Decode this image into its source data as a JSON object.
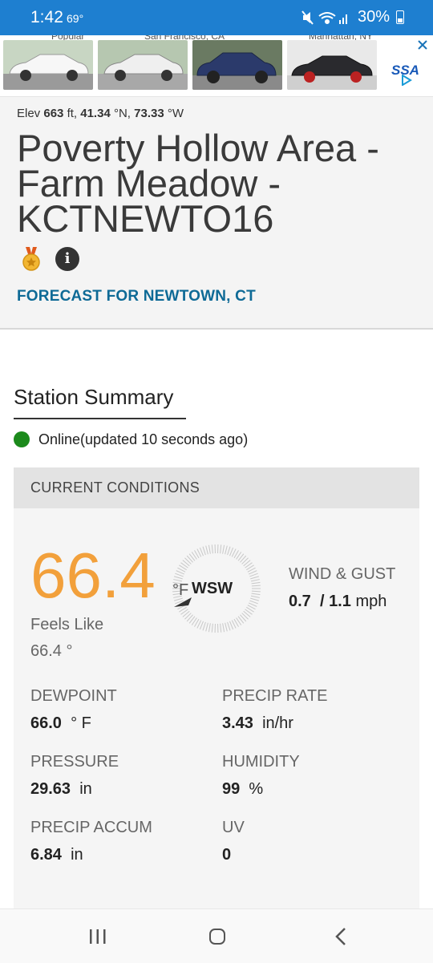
{
  "status_bar": {
    "time": "1:42",
    "temp": "69°",
    "battery": "30%"
  },
  "ad": {
    "top_text": [
      "Popular",
      "San Francisco, CA",
      "Manhattan, NY"
    ],
    "brand": "SSA",
    "car_colors": [
      "#ffffff",
      "#f3f3f3",
      "#2b3a6b",
      "#2a2a2e"
    ]
  },
  "header": {
    "elev_prefix": "Elev",
    "elev_value": "663",
    "elev_unit": "ft,",
    "lat_value": "41.34",
    "lat_unit": "°N,",
    "lon_value": "73.33",
    "lon_unit": "°W",
    "title_line1": "Poverty Hollow Area -",
    "title_line2": "Farm Meadow -",
    "title_line3": "KCTNEWTO16",
    "info_glyph": "i",
    "forecast_link": "FORECAST FOR NEWTOWN, CT"
  },
  "summary": {
    "title": "Station Summary",
    "status": "Online(updated 10 seconds ago)",
    "status_color": "#1c8a1c"
  },
  "conditions": {
    "heading": "CURRENT CONDITIONS",
    "temperature": "66.4",
    "temp_unit": "°F",
    "feels_like_label": "Feels Like",
    "feels_like_value": "66.4 °",
    "wind_dir": "WSW",
    "wind_label": "WIND & GUST",
    "wind_speed": "0.7",
    "wind_sep": "/",
    "wind_gust": "1.1",
    "wind_unit": "mph",
    "accent_color": "#f2a03b",
    "stats": {
      "dewpoint": {
        "label": "DEWPOINT",
        "value": "66.0",
        "unit": "° F"
      },
      "precip_rate": {
        "label": "PRECIP RATE",
        "value": "3.43",
        "unit": "in/hr"
      },
      "pressure": {
        "label": "PRESSURE",
        "value": "29.63",
        "unit": "in"
      },
      "humidity": {
        "label": "HUMIDITY",
        "value": "99",
        "unit": "%"
      },
      "precip_accum": {
        "label": "PRECIP ACCUM",
        "value": "6.84",
        "unit": "in"
      },
      "uv": {
        "label": "UV",
        "value": "0",
        "unit": ""
      }
    }
  }
}
